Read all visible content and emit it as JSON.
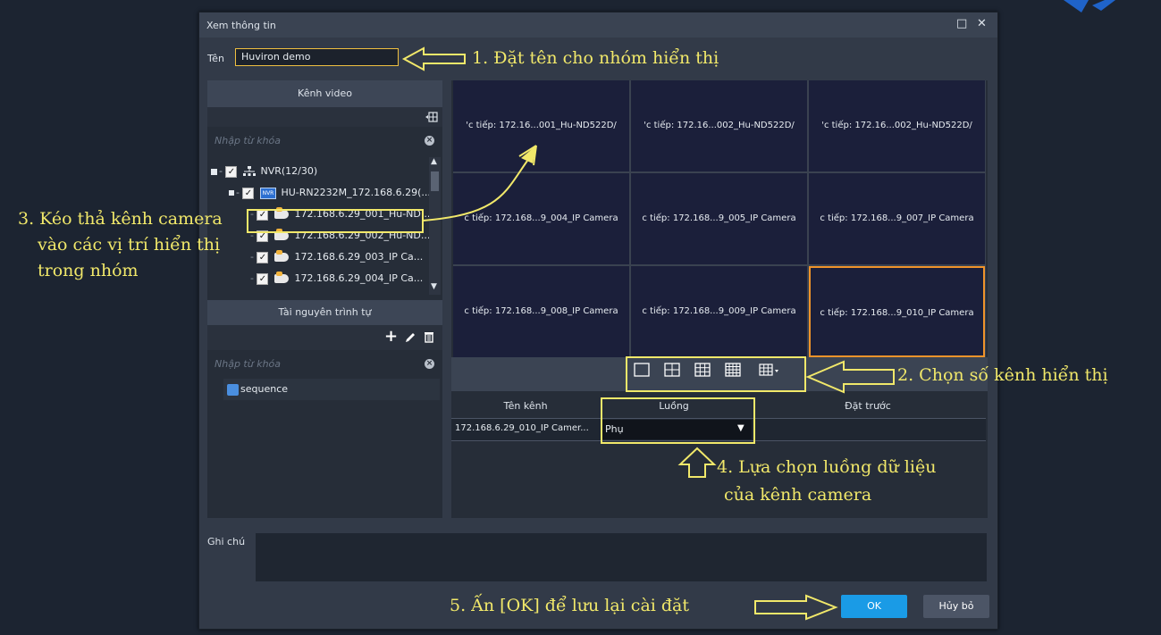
{
  "dialog": {
    "title": "Xem thông tin",
    "name_label": "Tên",
    "name_value": "Huviron demo",
    "note_label": "Ghi chú",
    "ok_label": "OK",
    "cancel_label": "Hủy bỏ"
  },
  "video_panel": {
    "header": "Kênh video",
    "search_placeholder": "Nhập từ khóa",
    "tree": [
      {
        "label": "NVR(12/30)"
      },
      {
        "label": "HU-RN2232M_172.168.6.29(..."
      },
      {
        "label": "172.168.6.29_001_Hu-ND..."
      },
      {
        "label": "172.168.6.29_002_Hu-ND..."
      },
      {
        "label": "172.168.6.29_003_IP Ca..."
      },
      {
        "label": "172.168.6.29_004_IP Ca..."
      }
    ]
  },
  "sequence_panel": {
    "header": "Tài nguyên trình tự",
    "search_placeholder": "Nhập từ khóa",
    "items": [
      {
        "label": "sequence"
      }
    ]
  },
  "grid": {
    "tiles": [
      "'c tiếp: 172.16...001_Hu-ND522D/",
      "'c tiếp: 172.16...002_Hu-ND522D/",
      "'c tiếp: 172.16...002_Hu-ND522D/",
      "c tiếp: 172.168...9_004_IP Camera",
      "c tiếp: 172.168...9_005_IP Camera",
      "c tiếp: 172.168...9_007_IP Camera",
      "c tiếp: 172.168...9_008_IP Camera",
      "c tiếp: 172.168...9_009_IP Camera",
      "c tiếp: 172.168...9_010_IP Camera"
    ],
    "selected_tile_index": 8
  },
  "table": {
    "headers": [
      "Tên kênh",
      "Luồng",
      "Đặt trước"
    ],
    "rows": [
      {
        "channel": "172.168.6.29_010_IP Camer...",
        "stream": "Phụ",
        "preset": ""
      }
    ]
  },
  "annotations": {
    "a1": "1. Đặt tên cho nhóm hiển thị",
    "a2": "2. Chọn số kênh hiển thị",
    "a3_l1": "3. Kéo thả kênh camera",
    "a3_l2": "vào các vị trí hiển thị",
    "a3_l3": "trong nhóm",
    "a4_l1": "4. Lựa chọn luồng dữ liệu",
    "a4_l2": "của kênh camera",
    "a5": "5. Ấn [OK] để lưu lại cài đặt"
  },
  "colors": {
    "annotation": "#f1e86a",
    "ok_button": "#1a9be6",
    "selected_tile_border": "#f0932a",
    "dialog_bg": "#323a48"
  }
}
